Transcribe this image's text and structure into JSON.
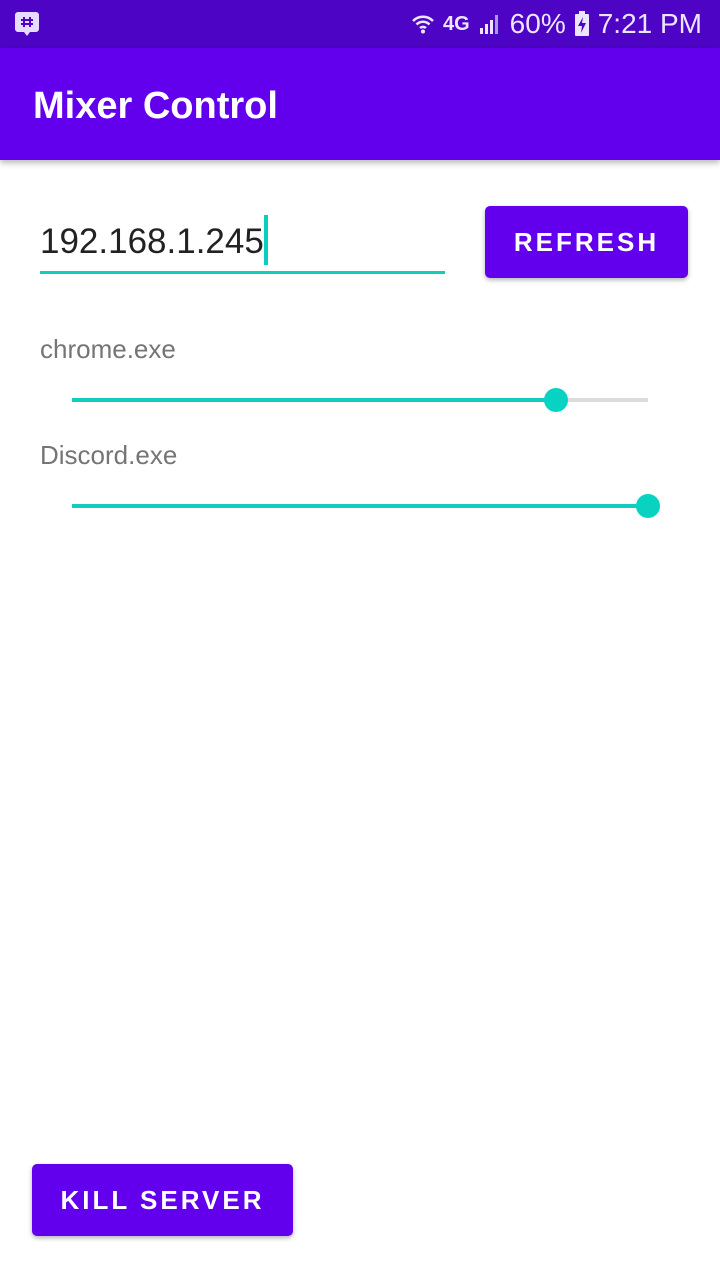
{
  "status_bar": {
    "app_icon": "grid-chat-icon",
    "wifi_icon": "wifi-icon",
    "network_label": "4G",
    "signal_icon": "signal-bars-icon",
    "battery_percent": "60%",
    "battery_icon": "battery-charging-icon",
    "time": "7:21 PM"
  },
  "app_bar": {
    "title": "Mixer Control"
  },
  "ip_input": {
    "value": "192.168.1.245"
  },
  "refresh_button": {
    "label": "REFRESH"
  },
  "sessions": [
    {
      "label": "chrome.exe",
      "volume": 0.84
    },
    {
      "label": "Discord.exe",
      "volume": 1.0
    }
  ],
  "kill_button": {
    "label": "KILL SERVER"
  },
  "colors": {
    "primary": "#6200ee",
    "primary_dark": "#4d04c4",
    "accent": "#12cdbd",
    "track": "#dcdcdc"
  }
}
